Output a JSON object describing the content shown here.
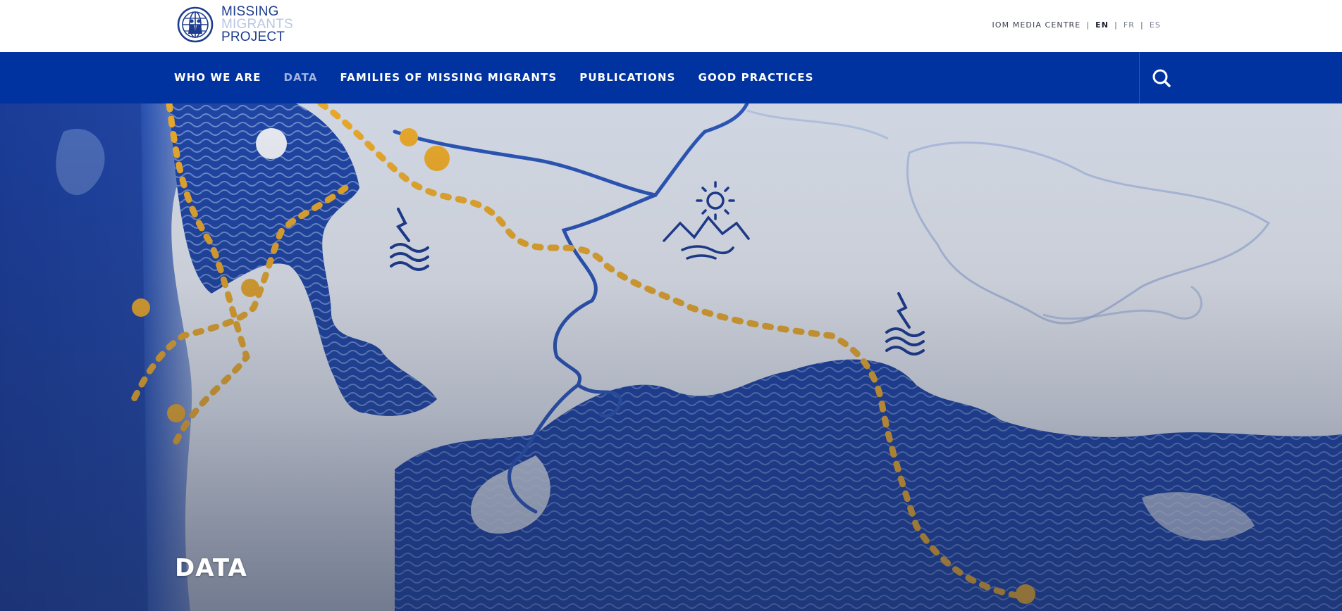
{
  "brand": {
    "logo_line1": "MISSING",
    "logo_line2": "MIGRANTS",
    "logo_line3": "PROJECT"
  },
  "utility": {
    "media_centre": "IOM MEDIA CENTRE",
    "separator": "|",
    "languages": [
      {
        "code": "EN",
        "active": true
      },
      {
        "code": "FR",
        "active": false
      },
      {
        "code": "ES",
        "active": false
      }
    ]
  },
  "nav": {
    "items": [
      {
        "label": "WHO WE ARE",
        "active": false
      },
      {
        "label": "DATA",
        "active": true
      },
      {
        "label": "FAMILIES OF MISSING MIGRANTS",
        "active": false
      },
      {
        "label": "PUBLICATIONS",
        "active": false
      },
      {
        "label": "GOOD PRACTICES",
        "active": false
      }
    ],
    "search_icon": "search-icon"
  },
  "hero": {
    "title": "DATA"
  },
  "colors": {
    "brand_blue": "#0033a0",
    "nav_active": "#9fb3dc",
    "route_gold": "#e8a82a",
    "ink_blue": "#1f45a3"
  }
}
